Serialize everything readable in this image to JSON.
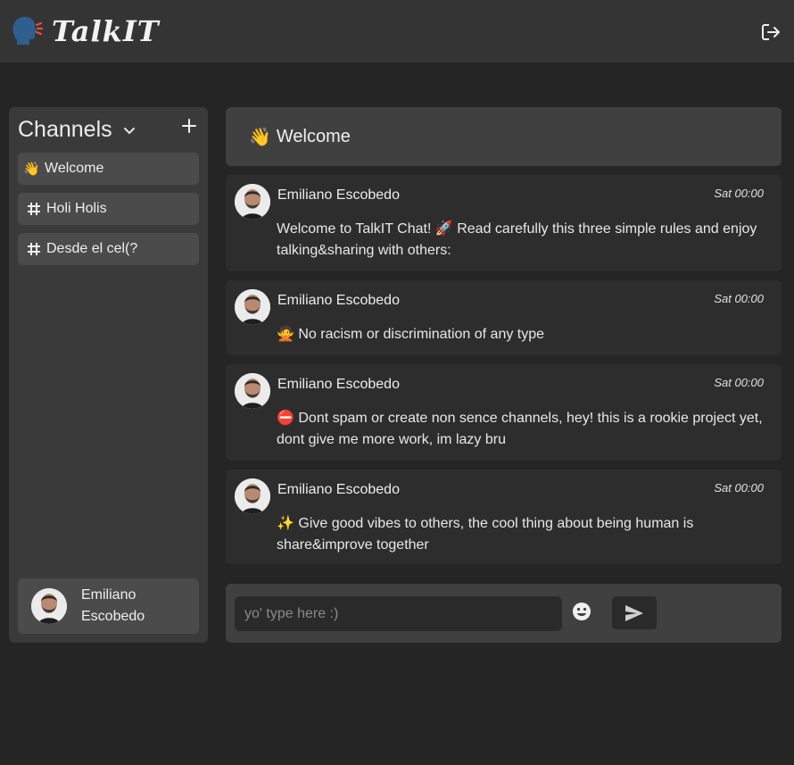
{
  "app": {
    "title": "TalkIT"
  },
  "sidebar": {
    "title": "Channels",
    "channels": [
      {
        "icon": "👋",
        "label": "Welcome"
      },
      {
        "icon": "hash-icon",
        "label": "Holi Holis"
      },
      {
        "icon": "hash-icon",
        "label": "Desde el cel(?"
      }
    ],
    "user": {
      "name": "Emiliano Escobedo"
    }
  },
  "chat": {
    "header": {
      "icon": "👋",
      "title": "Welcome"
    },
    "messages": [
      {
        "author": "Emiliano Escobedo",
        "time": "Sat 00:00",
        "text": "Welcome to TalkIT Chat! 🚀 Read carefully this three simple rules and enjoy talking&sharing with others:"
      },
      {
        "author": "Emiliano Escobedo",
        "time": "Sat 00:00",
        "text": "🙅 No racism or discrimination of any type"
      },
      {
        "author": "Emiliano Escobedo",
        "time": "Sat 00:00",
        "text": "⛔ Dont spam or create non sence channels, hey! this is a rookie project yet, dont give me more work, im lazy bru"
      },
      {
        "author": "Emiliano Escobedo",
        "time": "Sat 00:00",
        "text": "✨ Give good vibes to others, the cool thing about being human is share&improve together"
      }
    ]
  },
  "composer": {
    "placeholder": "yo' type here :)",
    "value": ""
  },
  "colors": {
    "background": "#252525",
    "topbar": "#343434",
    "panel": "#3a3a3a",
    "item": "#4b4b4b"
  }
}
